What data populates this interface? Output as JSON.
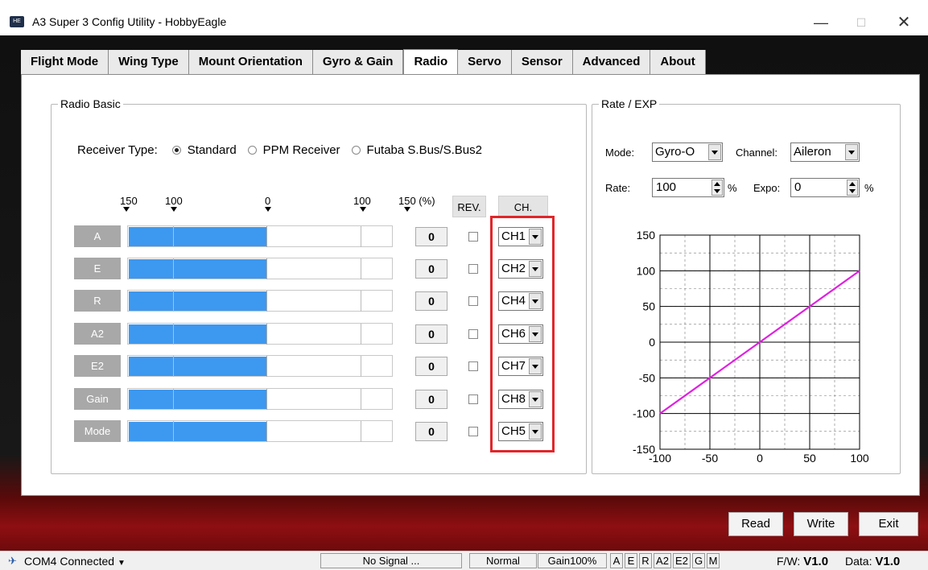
{
  "window": {
    "title": "A3 Super 3 Config Utility - HobbyEagle",
    "icon_text": "HE"
  },
  "tabs": [
    "Flight Mode",
    "Wing Type",
    "Mount Orientation",
    "Gyro & Gain",
    "Radio",
    "Servo",
    "Sensor",
    "Advanced",
    "About"
  ],
  "active_tab": "Radio",
  "radio_basic": {
    "title": "Radio Basic",
    "receiver_type_label": "Receiver Type:",
    "receiver_options": [
      "Standard",
      "PPM Receiver",
      "Futaba S.Bus/S.Bus2"
    ],
    "receiver_selected": "Standard",
    "scale_labels": [
      "150",
      "100",
      "0",
      "100",
      "150 (%)"
    ],
    "rev_header": "REV.",
    "ch_header": "CH.",
    "channels": [
      {
        "name": "A",
        "value": "0",
        "channel": "CH1",
        "reversed": false,
        "level": 0.5
      },
      {
        "name": "E",
        "value": "0",
        "channel": "CH2",
        "reversed": false,
        "level": 0.5
      },
      {
        "name": "R",
        "value": "0",
        "channel": "CH4",
        "reversed": false,
        "level": 0.5
      },
      {
        "name": "A2",
        "value": "0",
        "channel": "CH6",
        "reversed": false,
        "level": 0.5
      },
      {
        "name": "E2",
        "value": "0",
        "channel": "CH7",
        "reversed": false,
        "level": 0.5
      },
      {
        "name": "Gain",
        "value": "0",
        "channel": "CH8",
        "reversed": false,
        "level": 0.5
      },
      {
        "name": "Mode",
        "value": "0",
        "channel": "CH5",
        "reversed": false,
        "level": 0.5
      }
    ]
  },
  "rate_expo": {
    "title": "Rate / EXP",
    "mode_label": "Mode:",
    "mode_value": "Gyro-O",
    "channel_label": "Channel:",
    "channel_value": "Aileron",
    "rate_label": "Rate:",
    "rate_value": "100",
    "rate_unit": "%",
    "expo_label": "Expo:",
    "expo_value": "0",
    "expo_unit": "%"
  },
  "chart_data": {
    "type": "line",
    "title": "",
    "xlabel": "",
    "ylabel": "",
    "xlim": [
      -100,
      100
    ],
    "ylim": [
      -150,
      150
    ],
    "xticks": [
      "-100",
      "-50",
      "0",
      "50",
      "100"
    ],
    "yticks": [
      "150",
      "100",
      "50",
      "0",
      "-50",
      "-100",
      "-150"
    ],
    "grid": true,
    "line_color": "#e020e0",
    "series": [
      {
        "x": [
          -100,
          100
        ],
        "y": [
          -100,
          100
        ]
      }
    ]
  },
  "buttons": {
    "read": "Read",
    "write": "Write",
    "exit": "Exit"
  },
  "status": {
    "port": "COM4 Connected",
    "signal": "No Signal ...",
    "mode": "Normal",
    "gain": "Gain100%",
    "indicators": [
      "A",
      "E",
      "R",
      "A2",
      "E2",
      "G",
      "M"
    ],
    "fw_label": "F/W:",
    "fw_value": "V1.0",
    "data_label": "Data:",
    "data_value": "V1.0"
  },
  "colors": {
    "accent_bar": "#3d98f0",
    "highlight": "#e0262a",
    "curve": "#e020e0"
  }
}
